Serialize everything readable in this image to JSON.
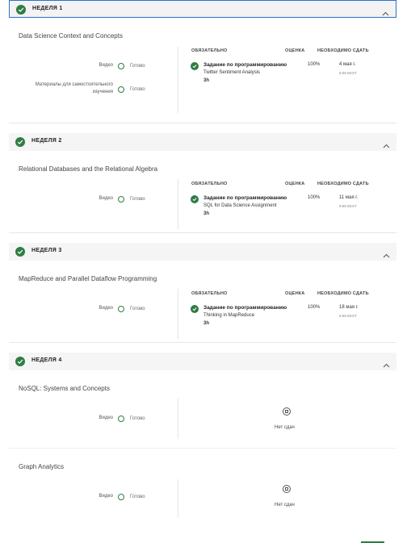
{
  "colors": {
    "accent": "#2e7d43",
    "focus_border": "#2a73cc"
  },
  "icons": {
    "check": "check-icon",
    "chevron": "chevron-up-icon",
    "empty": "empty-circle-icon"
  },
  "labels": {
    "video": "Видео",
    "ready": "Готово",
    "materials": "Материалы для самостоятельного изучения",
    "required": "ОБЯЗАТЕЛЬНО",
    "grade": "ОЦЕНКА",
    "due": "НЕОБХОДИМО СДАТЬ",
    "assignment": "Задание по программированию",
    "no_assignments": "Нет сдач"
  },
  "weeks": [
    {
      "title": "НЕДЕЛЯ 1",
      "lesson": "Data Science Context and Concepts",
      "assignment": {
        "name": "Twitter Sentiment Analysis",
        "duration": "3h",
        "grade": "100%",
        "due_date": "4 мая г.",
        "due_time": "9:59 EEST"
      }
    },
    {
      "title": "НЕДЕЛЯ 2",
      "lesson": "Relational Databases and the Relational Algebra",
      "assignment": {
        "name": "SQL for Data Science Assignment",
        "duration": "3h",
        "grade": "100%",
        "due_date": "11 мая г.",
        "due_time": "9:59 EEST"
      }
    },
    {
      "title": "НЕДЕЛЯ 3",
      "lesson": "MapReduce and Parallel Dataflow Programming",
      "assignment": {
        "name": "Thinking in MapReduce",
        "duration": "3h",
        "grade": "100%",
        "due_date": "18 мая г.",
        "due_time": "9:59 EEST"
      }
    },
    {
      "title": "НЕДЕЛЯ 4",
      "lessons": [
        "NoSQL: Systems and Concepts",
        "Graph Analytics"
      ]
    }
  ]
}
